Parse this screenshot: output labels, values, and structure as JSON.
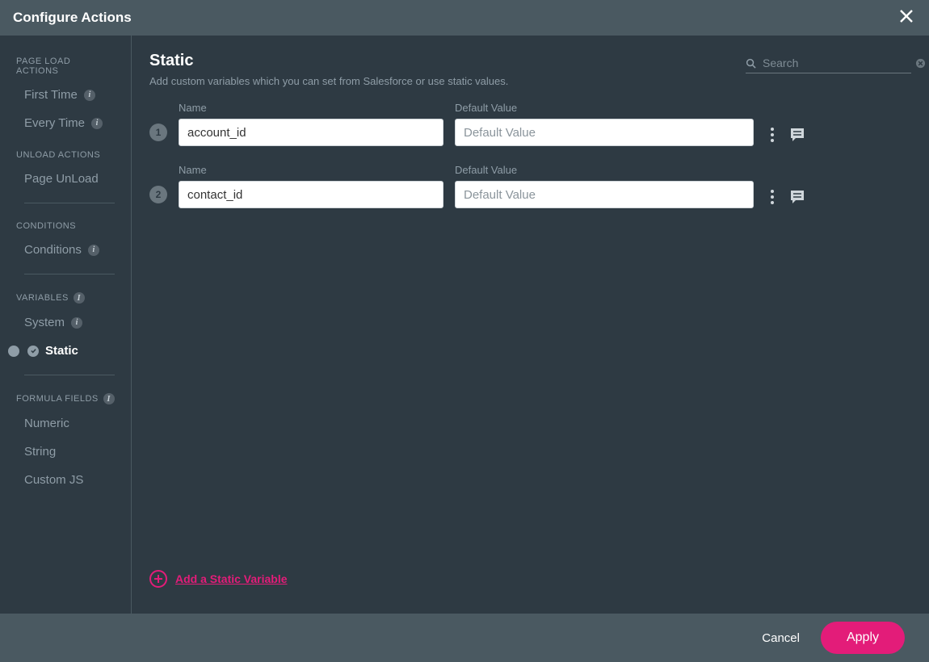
{
  "dialog": {
    "title": "Configure Actions"
  },
  "sidebar": {
    "sections": {
      "page_load": {
        "heading": "PAGE LOAD ACTIONS",
        "items": [
          "First Time",
          "Every Time"
        ]
      },
      "unload": {
        "heading": "UNLOAD ACTIONS",
        "items": [
          "Page UnLoad"
        ]
      },
      "conditions": {
        "heading": "CONDITIONS",
        "items": [
          "Conditions"
        ]
      },
      "variables": {
        "heading": "VARIABLES",
        "items": [
          "System",
          "Static"
        ]
      },
      "formula": {
        "heading": "FORMULA FIELDS",
        "items": [
          "Numeric",
          "String",
          "Custom JS"
        ]
      }
    }
  },
  "main": {
    "title": "Static",
    "subtitle": "Add custom variables which you can set from Salesforce or use static values.",
    "search_placeholder": "Search",
    "col_name": "Name",
    "col_default": "Default Value",
    "default_placeholder": "Default Value",
    "rows": [
      {
        "num": "1",
        "name": "account_id",
        "default": ""
      },
      {
        "num": "2",
        "name": "contact_id",
        "default": ""
      }
    ],
    "add_label": "Add a Static Variable"
  },
  "footer": {
    "cancel": "Cancel",
    "apply": "Apply"
  }
}
